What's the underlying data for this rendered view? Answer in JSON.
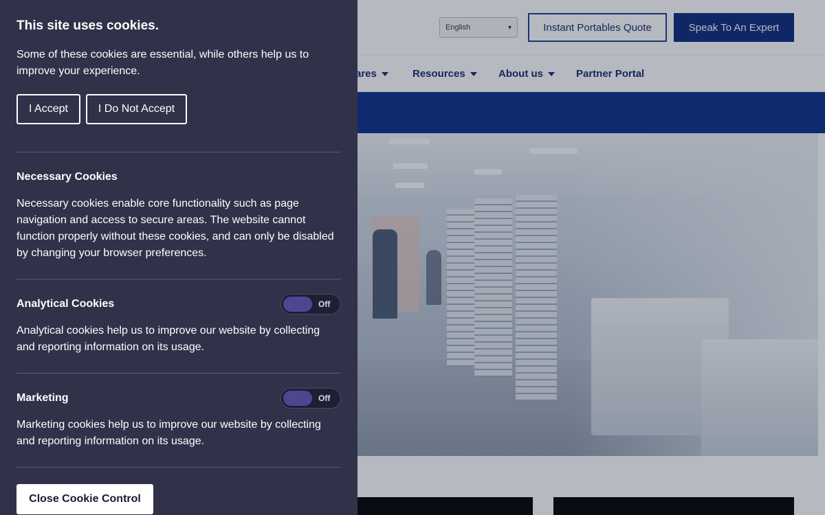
{
  "header": {
    "language": "English",
    "quote_button": "Instant Portables Quote",
    "expert_button": "Speak To An Expert"
  },
  "nav": {
    "items": [
      {
        "label": "ares"
      },
      {
        "label": "Resources"
      },
      {
        "label": "About us"
      },
      {
        "label": "Partner Portal"
      }
    ]
  },
  "cookie_panel": {
    "title": "This site uses cookies.",
    "intro": "Some of these cookies are essential, while others help us to improve your experience.",
    "accept_label": "I Accept",
    "reject_label": "I Do Not Accept",
    "necessary": {
      "heading": "Necessary Cookies",
      "text": "Necessary cookies enable core functionality such as page navigation and access to secure areas. The website cannot function properly without these cookies, and can only be disabled by changing your browser preferences."
    },
    "analytical": {
      "heading": "Analytical Cookies",
      "text": "Analytical cookies help us to improve our website by collecting and reporting information on its usage.",
      "toggle_state": "Off"
    },
    "marketing": {
      "heading": "Marketing",
      "text": "Marketing cookies help us to improve our website by collecting and reporting information on its usage.",
      "toggle_state": "Off"
    },
    "close_label": "Close Cookie Control"
  },
  "colors": {
    "panel_bg": "#313149",
    "brand_navy": "#0a2a7a",
    "toggle_knob": "#4b4890"
  }
}
